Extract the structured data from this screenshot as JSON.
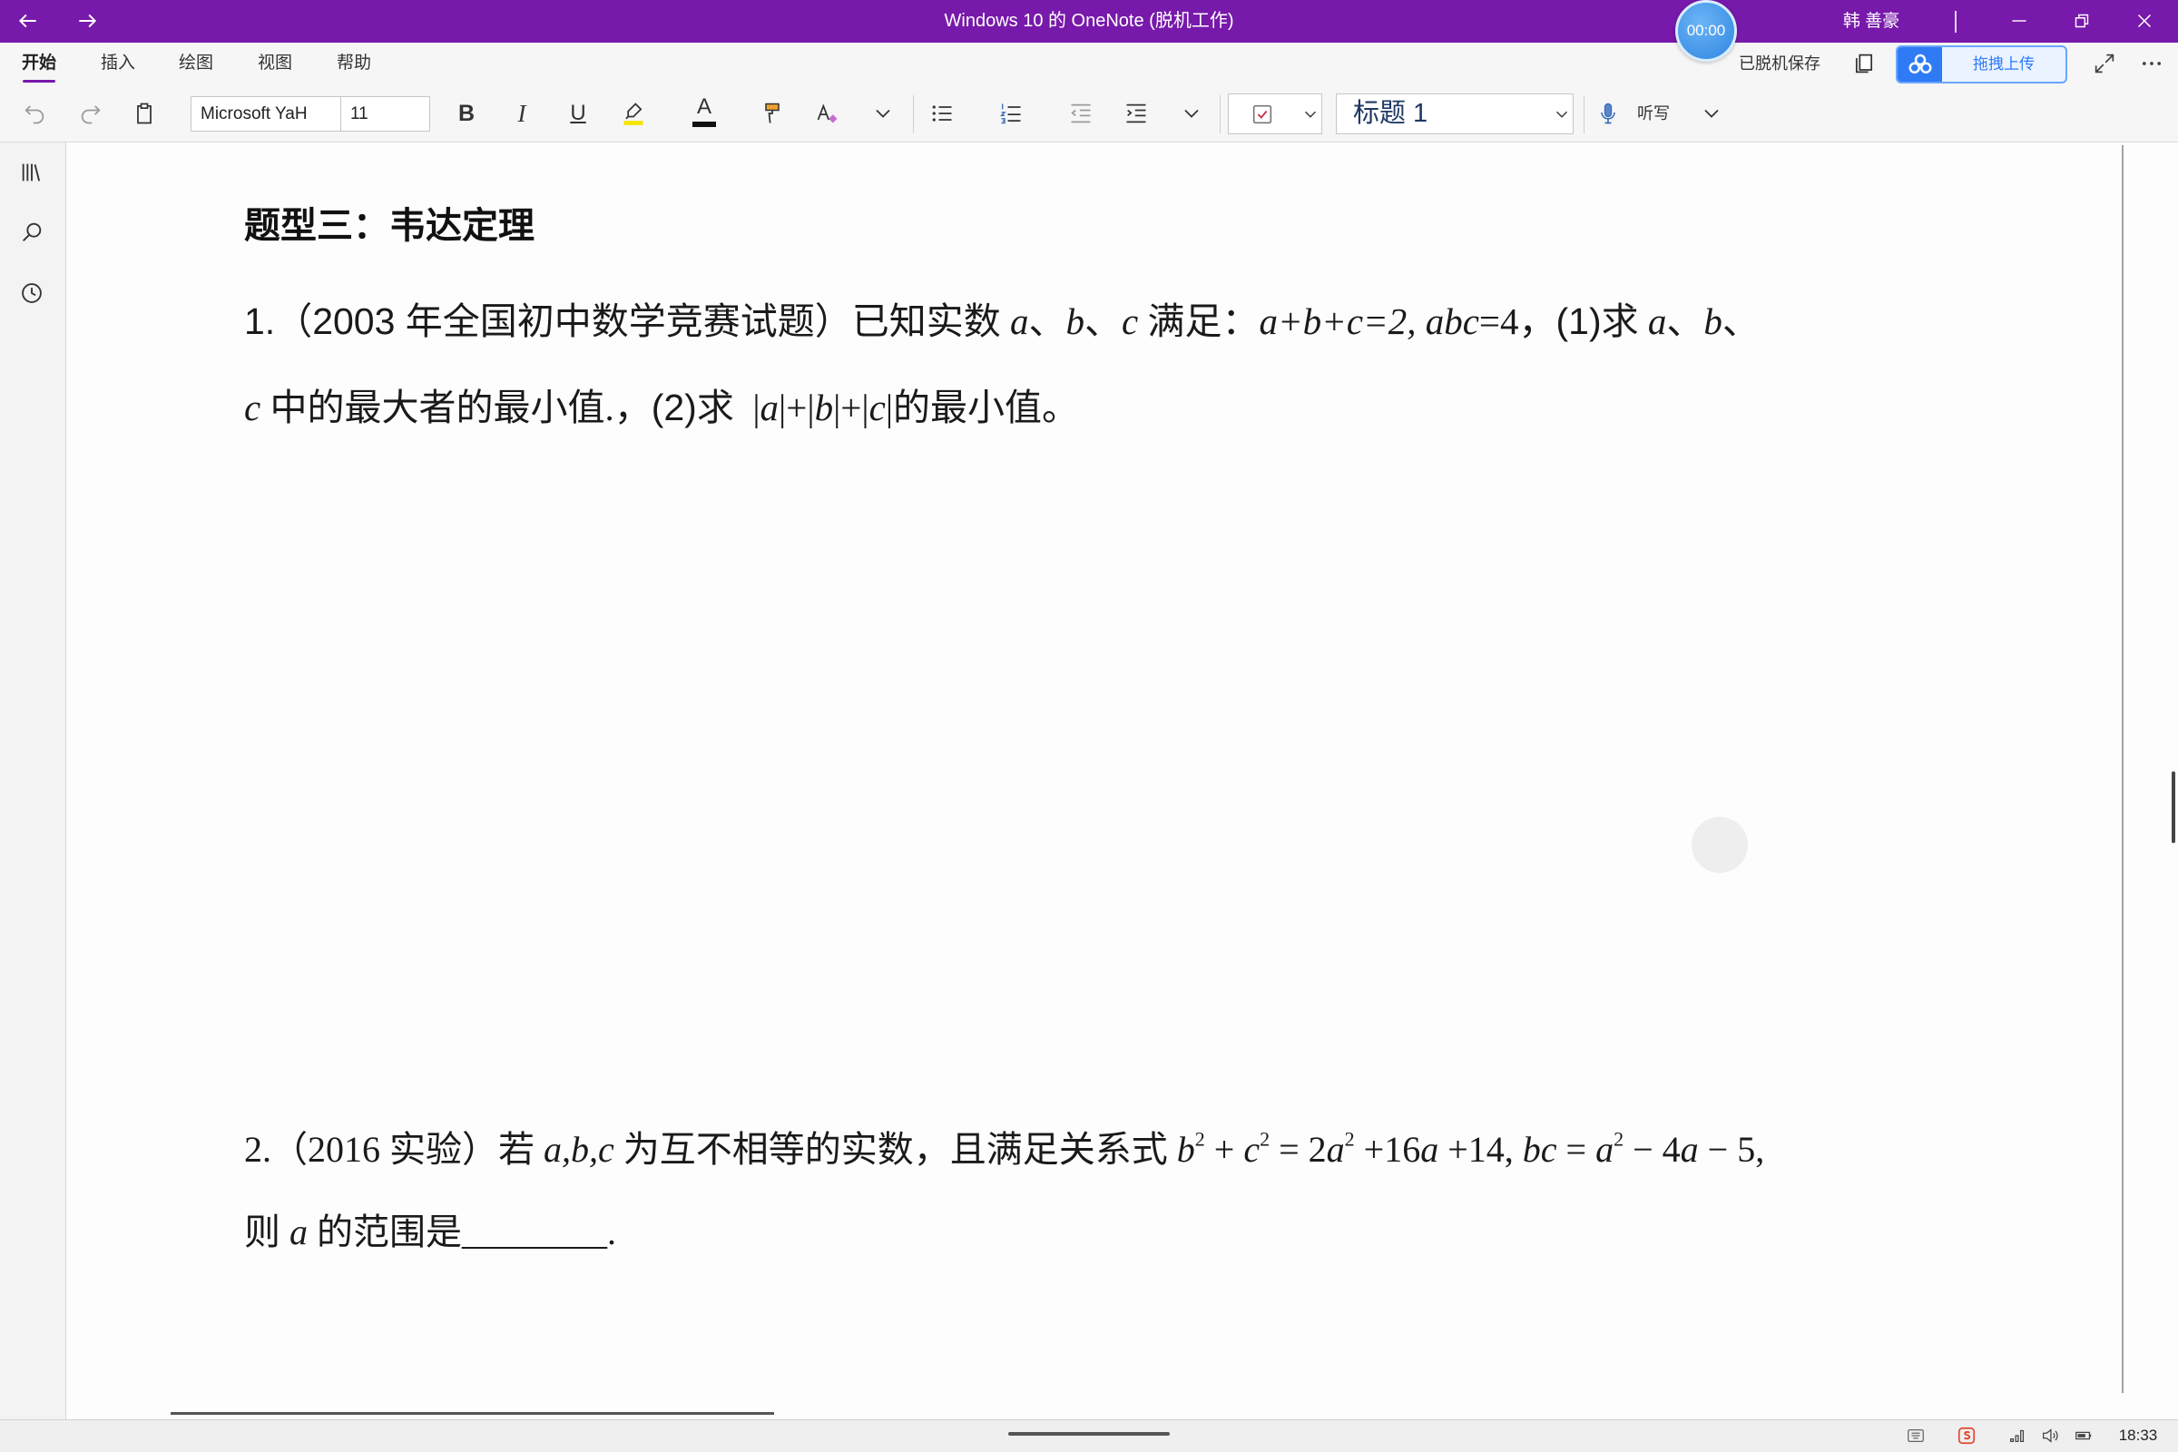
{
  "window": {
    "title": "Windows 10 的 OneNote (脱机工作)",
    "timer": "00:00",
    "user": "韩 善豪",
    "nav_icons": [
      "back-arrow-icon",
      "forward-arrow-icon"
    ],
    "control_icons": [
      "minimize-icon",
      "restore-icon",
      "close-icon"
    ]
  },
  "colors": {
    "title_bar": "#7719AA",
    "active_tab_underline": "#7719AA",
    "upload_accent": "#2F7BF6",
    "heading_style_text": "#1F3864",
    "highlighter": "#F5E400"
  },
  "ribbon": {
    "tabs": [
      {
        "label": "开始",
        "active": true
      },
      {
        "label": "插入",
        "active": false
      },
      {
        "label": "绘图",
        "active": false
      },
      {
        "label": "视图",
        "active": false
      },
      {
        "label": "帮助",
        "active": false
      }
    ],
    "save_status": "已脱机保存",
    "upload_label": "拖拽上传",
    "right_icons": [
      "sheet-icon",
      "baidu-cloud-icon",
      "expand-icon",
      "more-icon"
    ],
    "toolbar": {
      "font_family_value": "Microsoft YaH",
      "font_size_value": "11",
      "bold_label": "B",
      "italic_label": "I",
      "underline_label": "U",
      "font_color_label": "A",
      "style_value": "标题 1",
      "dictate_label": "听写",
      "icons": [
        "undo-icon",
        "redo-icon",
        "clipboard-icon",
        "highlighter-icon",
        "format-painter-icon",
        "clear-formatting-icon",
        "bullets-icon",
        "numbering-icon",
        "decrease-indent-icon",
        "increase-indent-icon",
        "todo-tag-icon",
        "microphone-icon"
      ]
    }
  },
  "nav": {
    "icons": [
      "notebooks-icon",
      "search-icon",
      "recent-icon"
    ]
  },
  "page": {
    "heading": "题型三：韦达定理",
    "problem_1": {
      "line_1": [
        "1.（2003 ",
        "年全国初中数学竞赛试题）已知实数 ",
        "a",
        "、",
        "b",
        "、",
        "c",
        " 满足：",
        "a+b+c=2, abc",
        "=4，",
        "(1)",
        "求 ",
        "a",
        "、",
        "b",
        "、"
      ],
      "line_2": [
        "c",
        " 中的最大者的最小值.，",
        "(2)",
        "求  ",
        "|",
        "a",
        "|+|",
        "b",
        "|+|",
        "c",
        "|",
        "的最小值。"
      ]
    },
    "problem_2": {
      "line_1": [
        "2.（2016 实验）若 ",
        "a,b,c",
        " 为互不相等的实数，且满足关系式 ",
        "b",
        "2",
        " + ",
        "c",
        "2",
        " = 2",
        "a",
        "2",
        " +16",
        "a",
        " +14, ",
        "bc",
        " = ",
        "a",
        "2",
        " − 4",
        "a",
        " − 5,"
      ],
      "line_2": [
        "则 ",
        "a",
        " 的范围是",
        "________",
        "."
      ]
    }
  },
  "taskbar": {
    "clock": "18:33",
    "tray_icons": [
      "input-method-icon",
      "sogou-icon",
      "network-icon",
      "volume-icon",
      "battery-icon"
    ]
  }
}
